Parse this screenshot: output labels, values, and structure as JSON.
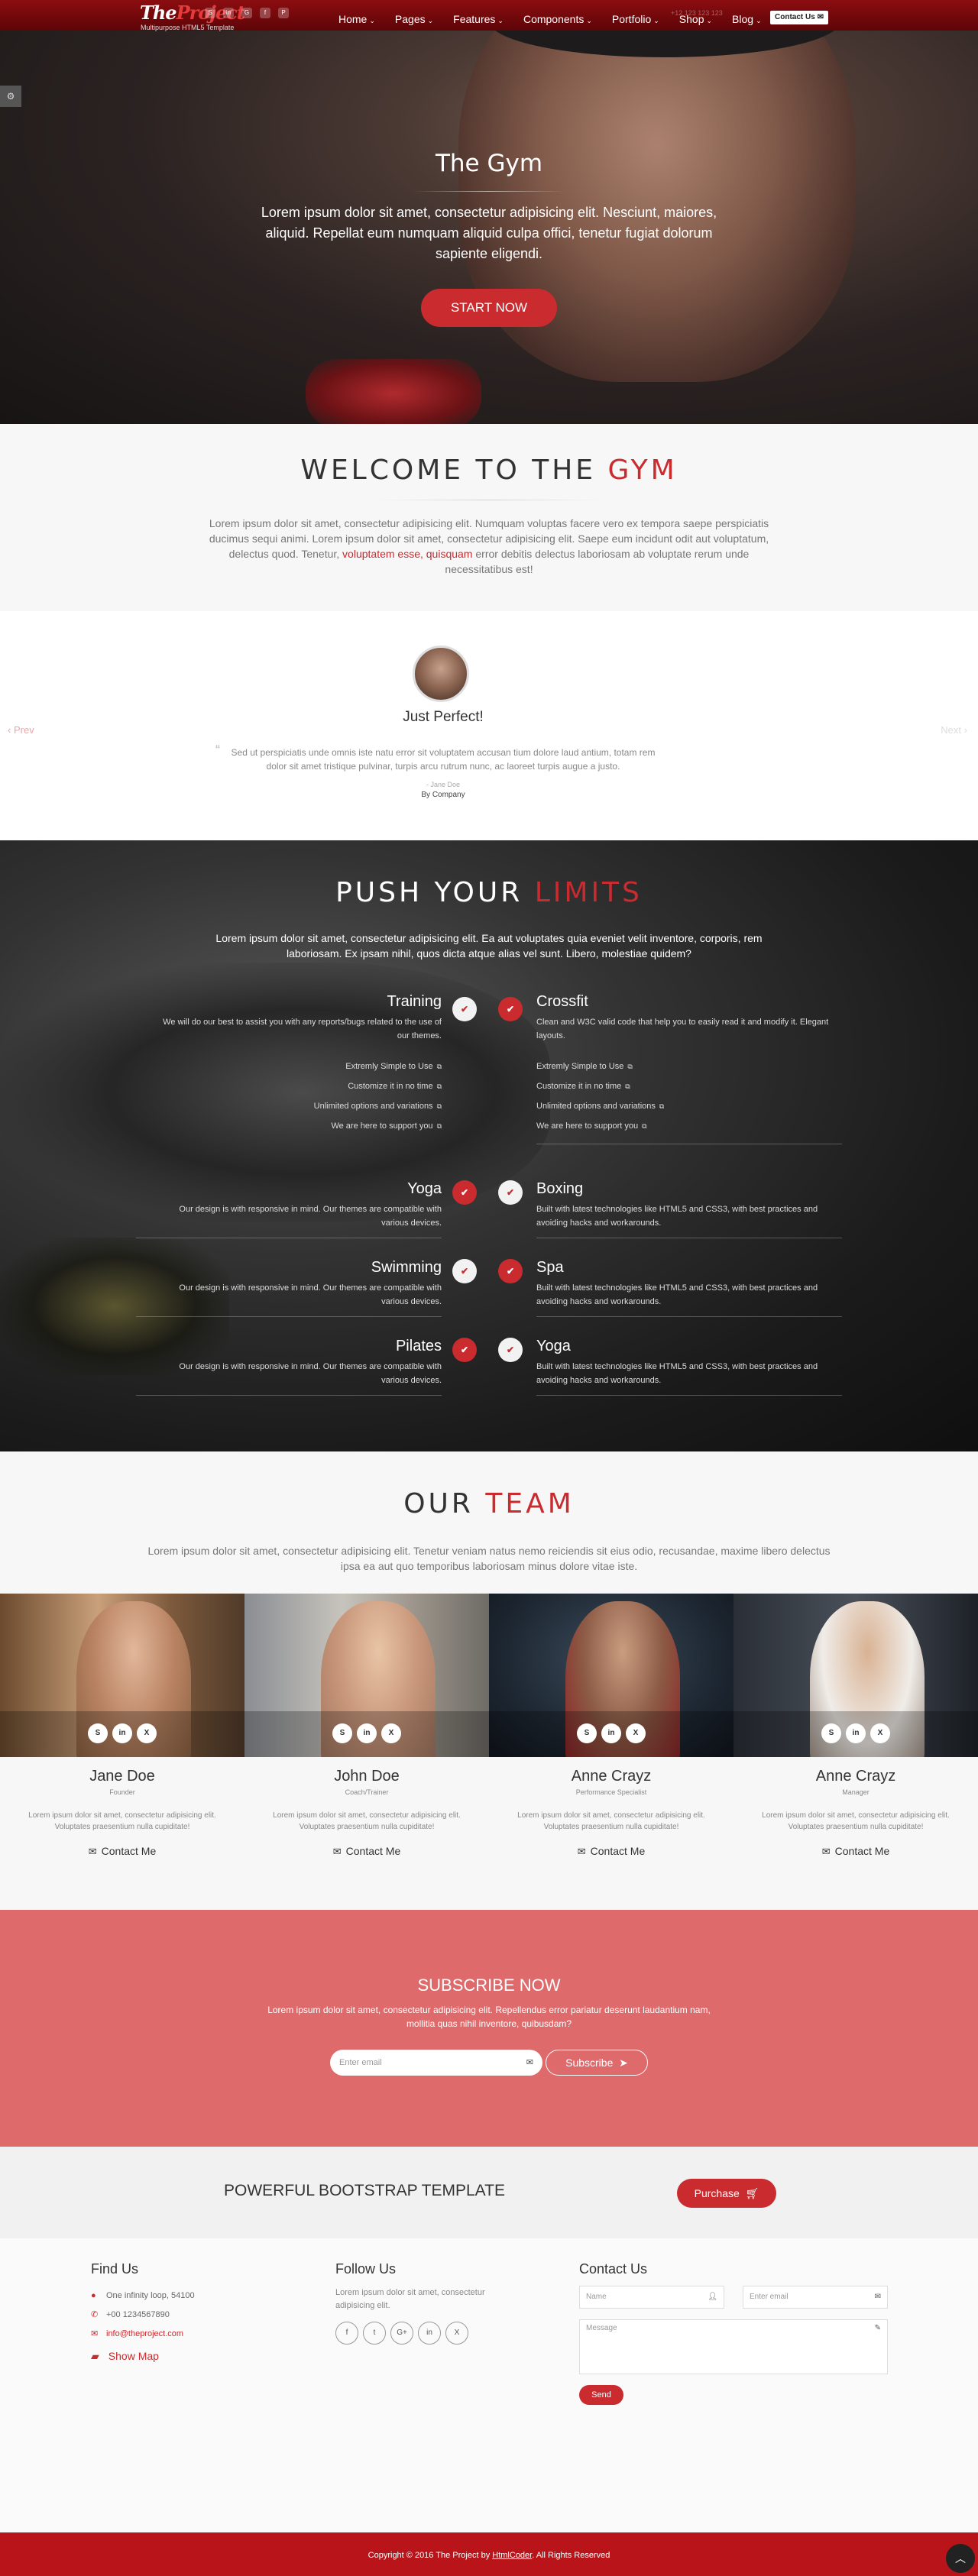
{
  "header": {
    "logo_part1": "The",
    "logo_part2": "Project",
    "tagline": "Multipurpose HTML5 Template",
    "social_icons": [
      "skype-icon",
      "linkedin-icon",
      "google-plus-icon",
      "facebook-icon",
      "pinterest-icon"
    ],
    "nav": [
      {
        "label": "Home"
      },
      {
        "label": "Pages"
      },
      {
        "label": "Features"
      },
      {
        "label": "Components"
      },
      {
        "label": "Portfolio"
      },
      {
        "label": "Shop"
      },
      {
        "label": "Blog"
      }
    ],
    "phone": "+12 123 123 123",
    "contact_button": "Contact Us"
  },
  "hero": {
    "title": "The Gym",
    "text": "Lorem ipsum dolor sit amet, consectetur adipisicing elit. Nesciunt, maiores, aliquid. Repellat eum numquam aliquid culpa offici, tenetur fugiat dolorum sapiente eligendi.",
    "button": "START NOW"
  },
  "welcome": {
    "title_part1": "WELCOME TO THE",
    "title_part2": "GYM",
    "text_1": "Lorem ipsum dolor sit amet, consectetur adipisicing elit. Numquam voluptas facere vero ex tempora saepe perspiciatis ducimus sequi animi. Lorem ipsum dolor sit amet, consectetur adipisicing elit. Saepe eum incidunt odit aut voluptatum, delectus quod. Tenetur,",
    "text_link": "voluptatem esse, quisquam",
    "text_2": "error debitis delectus laboriosam ab voluptate rerum unde necessitatibus est!"
  },
  "testimonial": {
    "prev": "Prev",
    "next": "Next",
    "title": "Just Perfect!",
    "quote": "Sed ut perspiciatis unde omnis iste natu error sit voluptatem accusan tium dolore laud antium, totam rem dolor sit amet tristique pulvinar, turpis arcu rutrum nunc, ac laoreet turpis augue a justo.",
    "author": "- Jane Doe",
    "company": "By Company"
  },
  "push": {
    "title_part1": "PUSH YOUR",
    "title_part2": "LIMITS",
    "intro": "Lorem ipsum dolor sit amet, consectetur adipisicing elit. Ea aut voluptates quia eveniet velit inventore, corporis, rem laboriosam. Ex ipsam nihil, quos dicta atque alias vel sunt. Libero, molestiae quidem?",
    "training": {
      "title": "Training",
      "text": "We will do our best to assist you with any reports/bugs related to the use of our themes.",
      "items": [
        "Extremly Simple to Use",
        "Customize it in no time",
        "Unlimited options and variations",
        "We are here to support you"
      ]
    },
    "crossfit": {
      "title": "Crossfit",
      "text": "Clean and W3C valid code that help you to easily read it and modify it. Elegant layouts.",
      "items": [
        "Extremly Simple to Use",
        "Customize it in no time",
        "Unlimited options and variations",
        "We are here to support you"
      ]
    },
    "yoga": {
      "title": "Yoga",
      "text": "Our design is with responsive in mind. Our themes are compatible with various devices."
    },
    "boxing": {
      "title": "Boxing",
      "text": "Built with latest technologies like HTML5 and CSS3, with best practices and avoiding hacks and workarounds."
    },
    "swimming": {
      "title": "Swimming",
      "text": "Our design is with responsive in mind. Our themes are compatible with various devices."
    },
    "spa": {
      "title": "Spa",
      "text": "Built with latest technologies like HTML5 and CSS3, with best practices and avoiding hacks and workarounds."
    },
    "pilates": {
      "title": "Pilates",
      "text": "Our design is with responsive in mind. Our themes are compatible with various devices."
    },
    "yoga2": {
      "title": "Yoga",
      "text": "Built with latest technologies like HTML5 and CSS3, with best practices and avoiding hacks and workarounds."
    }
  },
  "team": {
    "title_part1": "OUR",
    "title_part2": "TEAM",
    "intro": "Lorem ipsum dolor sit amet, consectetur adipisicing elit. Tenetur veniam natus nemo reiciendis sit eius odio, recusandae, maxime libero delectus ipsa ea aut quo temporibus laboriosam minus dolore vitae iste.",
    "members": [
      {
        "name": "Jane Doe",
        "role": "Founder",
        "desc": "Lorem ipsum dolor sit amet, consectetur adipisicing elit. Voluptates praesentium nulla cupiditate!",
        "contact": "Contact Me"
      },
      {
        "name": "John Doe",
        "role": "Coach/Trainer",
        "desc": "Lorem ipsum dolor sit amet, consectetur adipisicing elit. Voluptates praesentium nulla cupiditate!",
        "contact": "Contact Me"
      },
      {
        "name": "Anne Crayz",
        "role": "Performance Specialist",
        "desc": "Lorem ipsum dolor sit amet, consectetur adipisicing elit. Voluptates praesentium nulla cupiditate!",
        "contact": "Contact Me"
      },
      {
        "name": "Anne Crayz",
        "role": "Manager",
        "desc": "Lorem ipsum dolor sit amet, consectetur adipisicing elit. Voluptates praesentium nulla cupiditate!",
        "contact": "Contact Me"
      }
    ]
  },
  "subscribe": {
    "title": "SUBSCRIBE NOW",
    "text": "Lorem ipsum dolor sit amet, consectetur adipisicing elit. Repellendus error pariatur deserunt laudantium nam, mollitia quas nihil inventore, quibusdam?",
    "email_placeholder": "Enter email",
    "button": "Subscribe"
  },
  "purchase": {
    "title": "POWERFUL BOOTSTRAP TEMPLATE",
    "button": "Purchase"
  },
  "footer": {
    "find_us": {
      "title": "Find Us",
      "address": "One infinity loop, 54100",
      "phone": "+00 1234567890",
      "email": "info@theproject.com",
      "show_map": "Show Map"
    },
    "follow_us": {
      "title": "Follow Us",
      "text": "Lorem ipsum dolor sit amet, consectetur adipisicing elit."
    },
    "contact_us": {
      "title": "Contact Us",
      "name_placeholder": "Name",
      "email_placeholder": "Enter email",
      "message_placeholder": "Message",
      "send": "Send"
    }
  },
  "bottom": {
    "copy_1": "Copyright © 2016 The Project by",
    "copy_link": "HtmlCoder",
    "copy_2": ". All Rights Reserved"
  },
  "colors": {
    "accent": "#c92b2f",
    "header": "#8b0d10",
    "subscribe_bg": "#de6a6b",
    "footer_bar": "#b8141a"
  }
}
